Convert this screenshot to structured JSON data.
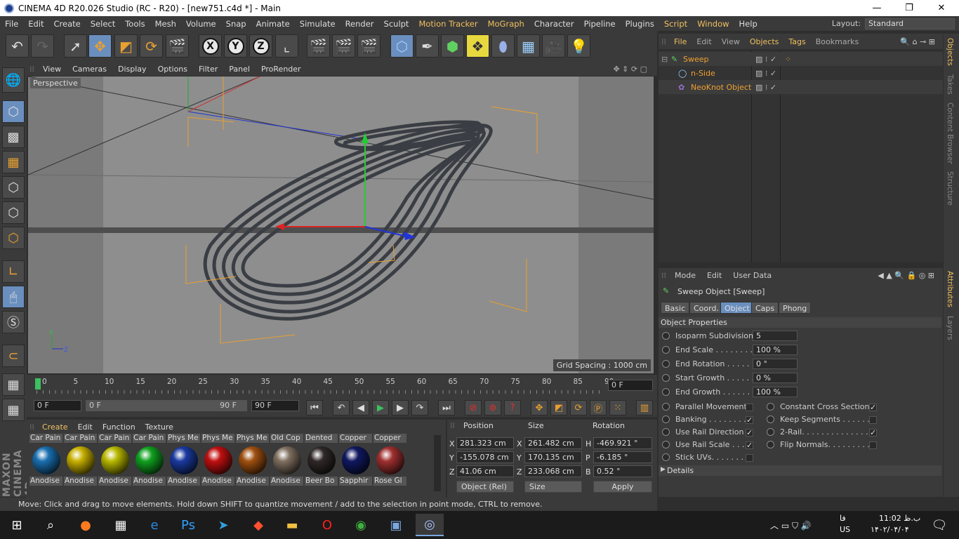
{
  "window": {
    "title": "CINEMA 4D R20.026 Studio (RC - R20) - [new751.c4d *] - Main",
    "min": "—",
    "max": "❐",
    "close": "✕"
  },
  "menu": [
    "File",
    "Edit",
    "Create",
    "Select",
    "Tools",
    "Mesh",
    "Volume",
    "Snap",
    "Animate",
    "Simulate",
    "Render",
    "Sculpt",
    "Motion Tracker",
    "MoGraph",
    "Character",
    "Pipeline",
    "Plugins",
    "Script",
    "Window",
    "Help"
  ],
  "layout": {
    "label": "Layout:",
    "value": "Standard"
  },
  "viewport": {
    "menu": [
      "View",
      "Cameras",
      "Display",
      "Options",
      "Filter",
      "Panel",
      "ProRender"
    ],
    "label": "Perspective",
    "grid_spacing": "Grid Spacing : 1000 cm"
  },
  "timeline": {
    "ticks": [
      "0",
      "5",
      "10",
      "15",
      "20",
      "25",
      "30",
      "35",
      "40",
      "45",
      "50",
      "55",
      "60",
      "65",
      "70",
      "75",
      "80",
      "85",
      "90"
    ],
    "current": "0 F",
    "start": "0 F",
    "range_start": "0 F",
    "range_end": "90 F",
    "end": "90 F"
  },
  "materials": {
    "menu": [
      "Create",
      "Edit",
      "Function",
      "Texture"
    ],
    "items": [
      {
        "name": "Car Pain",
        "sub": "Anodise",
        "color": "#1a6fb0"
      },
      {
        "name": "Car Pain",
        "sub": "Anodise",
        "color": "#c8b000"
      },
      {
        "name": "Car Pain",
        "sub": "Anodise",
        "color": "#b8b800"
      },
      {
        "name": "Car Pain",
        "sub": "Anodise",
        "color": "#10a020"
      },
      {
        "name": "Phys Me",
        "sub": "Anodise",
        "color": "#1a3aa0"
      },
      {
        "name": "Phys Me",
        "sub": "Anodise",
        "color": "#c01010"
      },
      {
        "name": "Phys Me",
        "sub": "Anodise",
        "color": "#a05010"
      },
      {
        "name": "Old Cop",
        "sub": "Anodise",
        "color": "#807060"
      },
      {
        "name": "Dented",
        "sub": "Beer Bo",
        "color": "#302828"
      },
      {
        "name": "Copper",
        "sub": "Sapphir",
        "color": "#101860"
      },
      {
        "name": "Copper",
        "sub": "Rose Gl",
        "color": "#a03030"
      }
    ]
  },
  "coords": {
    "headers": [
      "Position",
      "Size",
      "Rotation"
    ],
    "pos": {
      "x": "281.323 cm",
      "y": "-155.078 cm",
      "z": "41.06 cm"
    },
    "size": {
      "x": "261.482 cm",
      "y": "170.135 cm",
      "z": "233.068 cm"
    },
    "rot": {
      "h": "-469.921 °",
      "p": "-6.185 °",
      "b": "0.52 °"
    },
    "axes": {
      "x": "X",
      "y": "Y",
      "z": "Z",
      "h": "H",
      "p": "P",
      "b": "B"
    },
    "mode": "Object (Rel)",
    "size_mode": "Size",
    "apply": "Apply"
  },
  "objects": {
    "menu": [
      "File",
      "Edit",
      "View",
      "Objects",
      "Tags",
      "Bookmarks"
    ],
    "items": [
      {
        "name": "Sweep"
      },
      {
        "name": "n-Side"
      },
      {
        "name": "NeoKnot Object"
      }
    ]
  },
  "attributes": {
    "menu": [
      "Mode",
      "Edit",
      "User Data"
    ],
    "title": "Sweep Object [Sweep]",
    "tabs": [
      "Basic",
      "Coord.",
      "Object",
      "Caps",
      "Phong"
    ],
    "section": "Object Properties",
    "props": [
      {
        "label": "Isoparm Subdivision",
        "value": "5"
      },
      {
        "label": "End Scale . . . . . . . . .",
        "value": "100 %"
      },
      {
        "label": "End Rotation . . . . . .",
        "value": "0 °"
      },
      {
        "label": "Start Growth . . . . . .",
        "value": "0 %"
      },
      {
        "label": "End Growth . . . . . . .",
        "value": "100 %"
      }
    ],
    "checks_left": [
      {
        "label": "Parallel Movement",
        "checked": ""
      },
      {
        "label": "Banking . . . . . . . .",
        "checked": "✓"
      },
      {
        "label": "Use Rail Direction",
        "checked": "✓"
      },
      {
        "label": "Use Rail Scale . . . .",
        "checked": "✓"
      },
      {
        "label": "Stick UVs. . . . . . . .",
        "checked": ""
      }
    ],
    "checks_right": [
      {
        "label": "Constant Cross Section",
        "checked": "✓"
      },
      {
        "label": "Keep Segments . . . . . .",
        "checked": ""
      },
      {
        "label": "2-Rail. . . . . . . . . . . . . . .",
        "checked": "✓"
      },
      {
        "label": "Flip Normals. . . . . . . . .",
        "checked": ""
      }
    ],
    "details": "Details"
  },
  "side_tabs": [
    "Objects",
    "Takes",
    "Content Browser",
    "Structure",
    "Attributes",
    "Layers"
  ],
  "brand": "MAXON CINEMA 4D",
  "status": "Move: Click and drag to move elements. Hold down SHIFT to quantize movement / add to the selection in point mode, CTRL to remove.",
  "taskbar": {
    "time": "11:02 ب.ظ",
    "date": "۱۴۰۲/۰۴/۰۴",
    "lang": "فا",
    "lang2": "US"
  }
}
